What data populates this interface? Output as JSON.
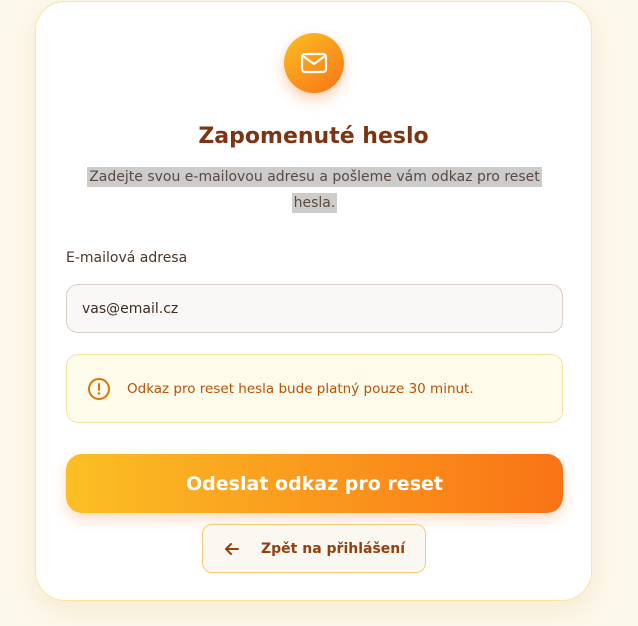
{
  "header": {
    "icon": "mail-icon",
    "title": "Zapomenuté heslo",
    "subtitle": "Zadejte svou e-mailovou adresu a pošleme vám odkaz pro reset hesla."
  },
  "form": {
    "email_label": "E-mailová adresa",
    "email_value": "vas@email.cz"
  },
  "notice": {
    "icon": "alert-circle-icon",
    "text": "Odkaz pro reset hesla bude platný pouze 30 minut."
  },
  "actions": {
    "submit_label": "Odeslat odkaz pro reset",
    "back_icon": "arrow-left-icon",
    "back_label": "Zpět na přihlášení"
  },
  "colors": {
    "accent_start": "#fbbf24",
    "accent_end": "#f97316",
    "title": "#7c3414",
    "warning_text": "#b45309"
  }
}
